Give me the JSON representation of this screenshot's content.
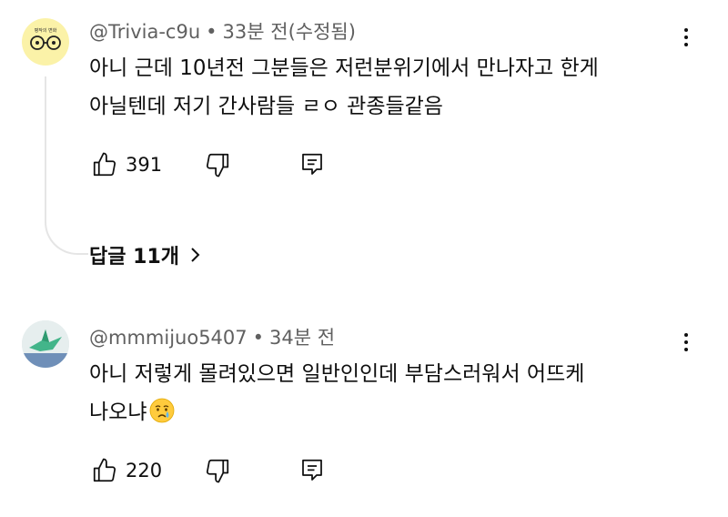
{
  "comments": [
    {
      "handle": "@Trivia-c9u",
      "time": "33분 전(수정됨)",
      "text_line1": "아니 근데 10년전 그분들은 저런분위기에서 만나자고 한게",
      "text_line2": "아닐텐데 저기 간사람들 ㄹㅇ 관종들같음",
      "likes": "391",
      "replies_label": "답글 11개",
      "avatar_text": "평작의 변화"
    },
    {
      "handle": "@mmmijuo5407",
      "time": "34분 전",
      "text_line1": "아니 저렇게 몰려있으면 일반인인데 부담스러워서 어뜨케",
      "text_line2": "나오냐",
      "emoji": "crying-face",
      "likes": "220"
    }
  ],
  "separator": "•",
  "icons": {
    "like": "thumbs-up-icon",
    "dislike": "thumbs-down-icon",
    "reply": "reply-comment-icon",
    "more": "more-vertical-icon",
    "chevron": "chevron-right-icon"
  },
  "colors": {
    "secondary_text": "#606060",
    "thread_line": "#e5e5e5",
    "avatar1_bg": "#fbf2a8"
  }
}
